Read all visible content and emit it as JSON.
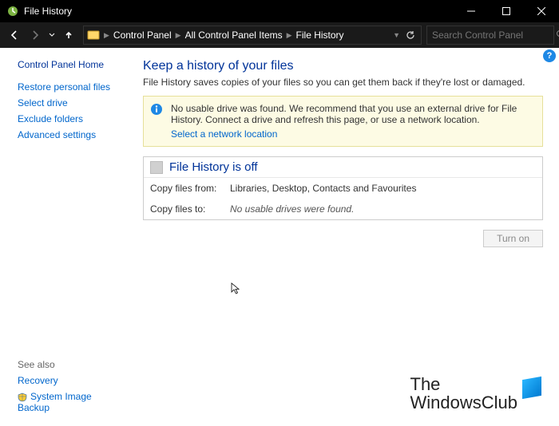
{
  "window": {
    "title": "File History"
  },
  "nav": {
    "breadcrumbs": [
      "Control Panel",
      "All Control Panel Items",
      "File History"
    ],
    "search_placeholder": "Search Control Panel"
  },
  "sidebar": {
    "home": "Control Panel Home",
    "links": [
      "Restore personal files",
      "Select drive",
      "Exclude folders",
      "Advanced settings"
    ],
    "see_also_label": "See also",
    "see_also": [
      "Recovery",
      "System Image Backup"
    ]
  },
  "main": {
    "heading": "Keep a history of your files",
    "subheading": "File History saves copies of your files so you can get them back if they're lost or damaged.",
    "info_message": "No usable drive was found. We recommend that you use an external drive for File History. Connect a drive and refresh this page, or use a network location.",
    "info_link": "Select a network location",
    "status_title": "File History is off",
    "copy_from_label": "Copy files from:",
    "copy_from_value": "Libraries, Desktop, Contacts and Favourites",
    "copy_to_label": "Copy files to:",
    "copy_to_value": "No usable drives were found.",
    "turn_on_label": "Turn on"
  },
  "branding": {
    "line1": "The",
    "line2": "WindowsClub"
  }
}
